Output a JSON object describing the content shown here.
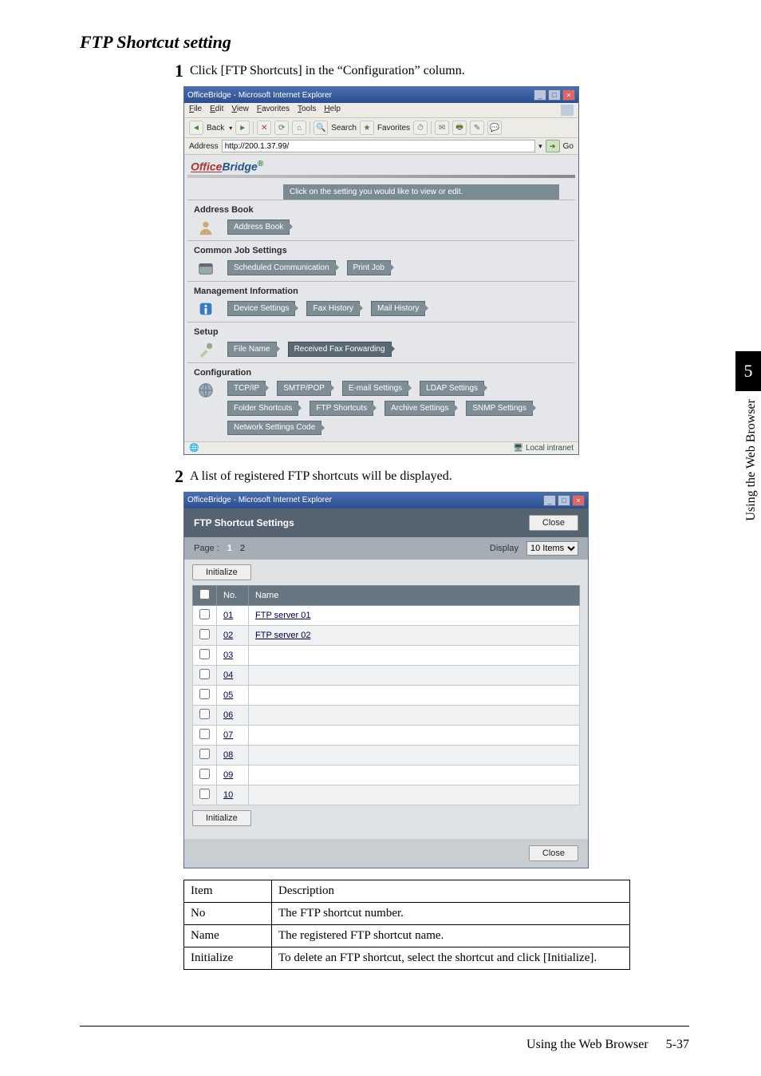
{
  "section_title": "FTP Shortcut setting",
  "steps": {
    "s1": {
      "num": "1",
      "text": "Click [FTP Shortcuts] in the “Configuration” column."
    },
    "s2": {
      "num": "2",
      "text": "A list of registered FTP shortcuts will be displayed."
    }
  },
  "ie1": {
    "title": "OfficeBridge - Microsoft Internet Explorer",
    "menu": {
      "file": "File",
      "edit": "Edit",
      "view": "View",
      "favorites": "Favorites",
      "tools": "Tools",
      "help": "Help"
    },
    "toolbar": {
      "back": "Back",
      "search": "Search",
      "favorites": "Favorites"
    },
    "address_label": "Address",
    "address_value": "http://200.1.37.99/",
    "go": "Go",
    "logo_prefix": "Office",
    "logo_main": "Bridge",
    "banner": "Click on the setting you would like to view or edit.",
    "groups": {
      "addr": {
        "title": "Address Book",
        "btn1": "Address Book"
      },
      "cjs": {
        "title": "Common Job Settings",
        "b1": "Scheduled Communication",
        "b2": "Print Job"
      },
      "mi": {
        "title": "Management Information",
        "b1": "Device Settings",
        "b2": "Fax History",
        "b3": "Mail History"
      },
      "setup": {
        "title": "Setup",
        "b1": "File Name",
        "b2": "Received Fax Forwarding"
      },
      "cfg": {
        "title": "Configuration",
        "r1": {
          "b1": "TCP/IP",
          "b2": "SMTP/POP",
          "b3": "E-mail Settings",
          "b4": "LDAP Settings"
        },
        "r2": {
          "b1": "Folder Shortcuts",
          "b2": "FTP Shortcuts",
          "b3": "Archive Settings",
          "b4": "SNMP Settings"
        },
        "r3": {
          "b1": "Network Settings Code"
        }
      }
    },
    "status_zone": "Local intranet"
  },
  "ie2": {
    "title": "OfficeBridge - Microsoft Internet Explorer",
    "header_title": "FTP Shortcut Settings",
    "close": "Close",
    "page_label": "Page :",
    "page_active": "1",
    "page_other": "2",
    "display_label": "Display",
    "display_value": "10 Items",
    "initialize": "Initialize",
    "cols": {
      "no": "No.",
      "name": "Name"
    },
    "rows": [
      {
        "no": "01",
        "name": "FTP server 01"
      },
      {
        "no": "02",
        "name": "FTP server 02"
      },
      {
        "no": "03",
        "name": ""
      },
      {
        "no": "04",
        "name": ""
      },
      {
        "no": "05",
        "name": ""
      },
      {
        "no": "06",
        "name": ""
      },
      {
        "no": "07",
        "name": ""
      },
      {
        "no": "08",
        "name": ""
      },
      {
        "no": "09",
        "name": ""
      },
      {
        "no": "10",
        "name": ""
      }
    ]
  },
  "desc": {
    "h1": "Item",
    "h2": "Description",
    "r1": {
      "c1": "No",
      "c2": "The FTP shortcut number."
    },
    "r2": {
      "c1": "Name",
      "c2": "The registered FTP shortcut name."
    },
    "r3": {
      "c1": "Initialize",
      "c2": "To delete an FTP shortcut, select the shortcut and click [Initialize]."
    }
  },
  "side": {
    "num": "5",
    "label": "Using the Web Browser"
  },
  "footer": {
    "text": "Using the Web Browser",
    "page": "5-37"
  }
}
